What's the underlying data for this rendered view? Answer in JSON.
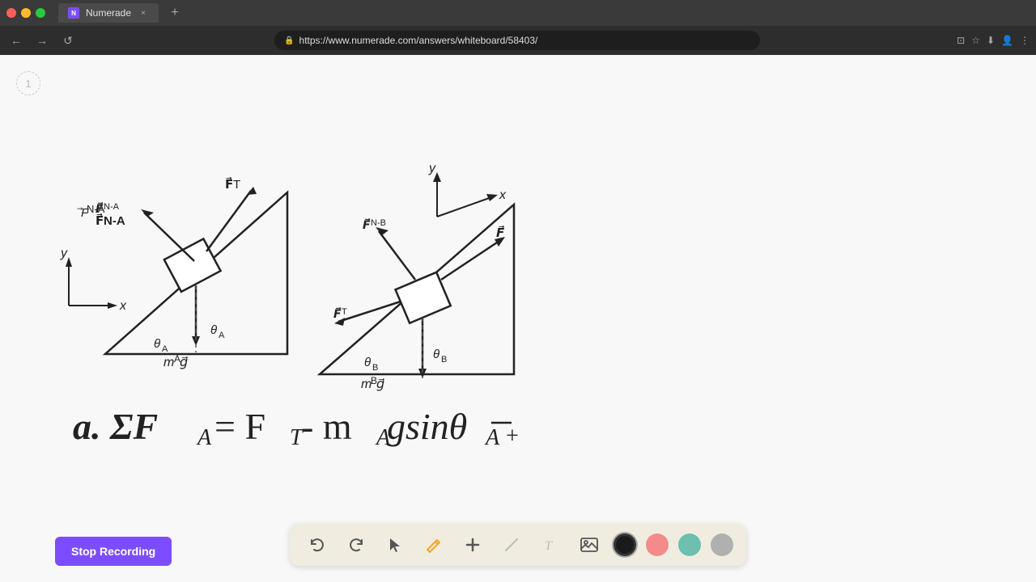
{
  "browser": {
    "title": "Numerade",
    "url": "https://www.numerade.com/answers/whiteboard/58403/",
    "tab_close": "×",
    "tab_new": "+"
  },
  "nav": {
    "back": "←",
    "forward": "→",
    "refresh": "↺",
    "lock_icon": "🔒"
  },
  "page": {
    "number": "1"
  },
  "toolbar": {
    "undo_label": "↺",
    "redo_label": "↻",
    "stop_recording": "Stop Recording",
    "colors": [
      "black",
      "pink",
      "teal",
      "gray"
    ]
  }
}
